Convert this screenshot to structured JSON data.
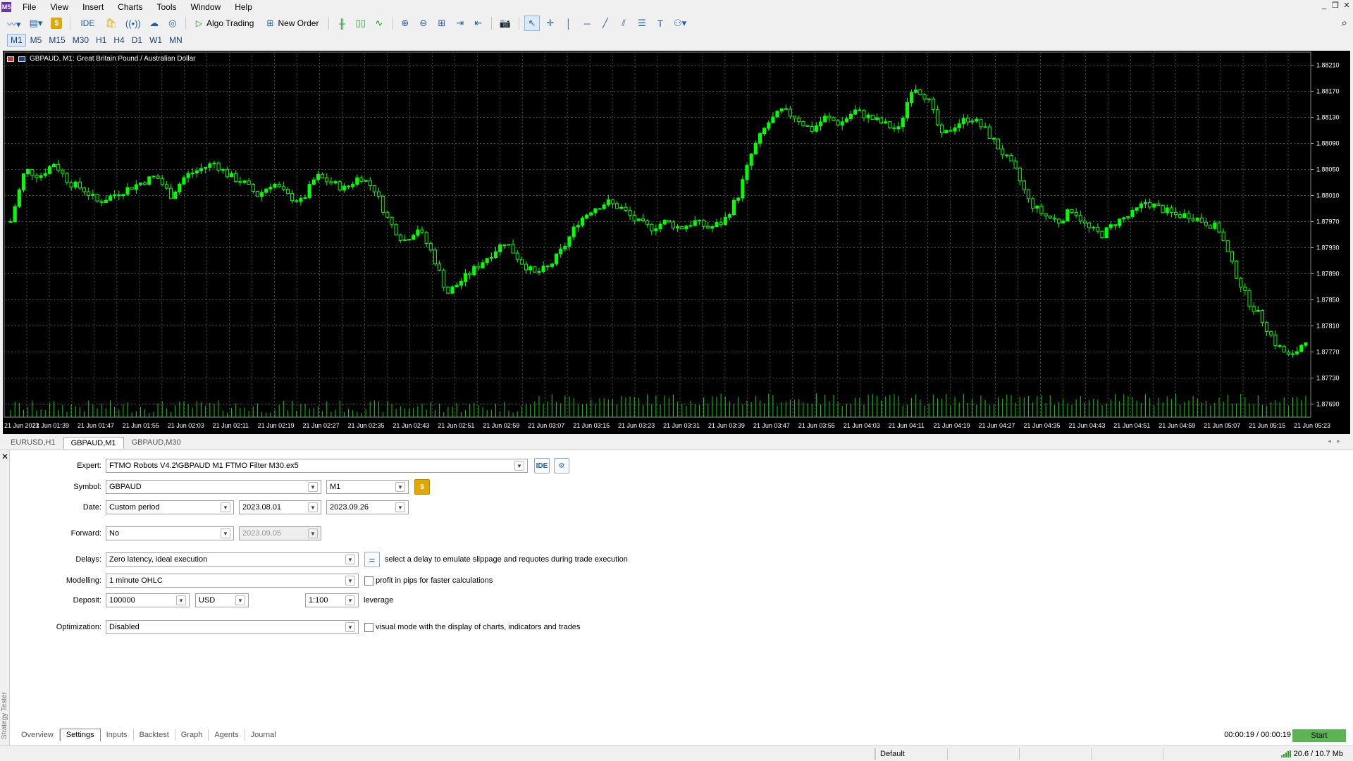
{
  "menu": [
    "File",
    "View",
    "Insert",
    "Charts",
    "Tools",
    "Window",
    "Help"
  ],
  "toolbar": {
    "ide_label": "IDE",
    "algo_trading_label": "Algo Trading",
    "new_order_label": "New Order"
  },
  "timeframes": [
    "M1",
    "M5",
    "M15",
    "M30",
    "H1",
    "H4",
    "D1",
    "W1",
    "MN"
  ],
  "active_timeframe": "M1",
  "chart": {
    "title": "GBPAUD, M1:  Great Britain Pound / Australian Dollar",
    "bull_color": "#00ff00",
    "bg_color": "#000000",
    "grid_color": "#4a4a4a"
  },
  "chart_data": {
    "type": "candlestick",
    "ylim": [
      1.8767,
      1.8823
    ],
    "y_ticks": [
      "1.88210",
      "1.88170",
      "1.88130",
      "1.88090",
      "1.88050",
      "1.88010",
      "1.87970",
      "1.87930",
      "1.87890",
      "1.87850",
      "1.87810",
      "1.87770",
      "1.87730",
      "1.87690"
    ],
    "x_ticks": [
      "21 Jun 2023",
      "21 Jun 01:39",
      "21 Jun 01:47",
      "21 Jun 01:55",
      "21 Jun 02:03",
      "21 Jun 02:11",
      "21 Jun 02:19",
      "21 Jun 02:27",
      "21 Jun 02:35",
      "21 Jun 02:43",
      "21 Jun 02:51",
      "21 Jun 02:59",
      "21 Jun 03:07",
      "21 Jun 03:15",
      "21 Jun 03:23",
      "21 Jun 03:31",
      "21 Jun 03:39",
      "21 Jun 03:47",
      "21 Jun 03:55",
      "21 Jun 04:03",
      "21 Jun 04:11",
      "21 Jun 04:19",
      "21 Jun 04:27",
      "21 Jun 04:35",
      "21 Jun 04:43",
      "21 Jun 04:51",
      "21 Jun 04:59",
      "21 Jun 05:07",
      "21 Jun 05:15",
      "21 Jun 05:23"
    ],
    "close_path": [
      1.8797,
      1.8805,
      1.8804,
      1.8806,
      1.8803,
      1.8802,
      1.88,
      1.8801,
      1.8802,
      1.8803,
      1.8804,
      1.8801,
      1.8804,
      1.8805,
      1.8806,
      1.8804,
      1.8803,
      1.8801,
      1.8803,
      1.8801,
      1.88,
      1.8804,
      1.8803,
      1.8802,
      1.8804,
      1.8802,
      1.8797,
      1.8794,
      1.8796,
      1.8792,
      1.8786,
      1.8788,
      1.879,
      1.8792,
      1.8794,
      1.8791,
      1.8789,
      1.879,
      1.8793,
      1.8797,
      1.8799,
      1.88,
      1.8799,
      1.8797,
      1.8796,
      1.8797,
      1.8796,
      1.8797,
      1.8796,
      1.8797,
      1.8801,
      1.8808,
      1.8812,
      1.8814,
      1.8813,
      1.8811,
      1.8813,
      1.8812,
      1.8814,
      1.8813,
      1.8812,
      1.8811,
      1.8818,
      1.8816,
      1.881,
      1.8812,
      1.8813,
      1.8811,
      1.8808,
      1.8805,
      1.88,
      1.8798,
      1.8797,
      1.8799,
      1.8796,
      1.8795,
      1.8797,
      1.8798,
      1.88,
      1.8799,
      1.8798,
      1.8798,
      1.8797,
      1.8796,
      1.879,
      1.8785,
      1.8782,
      1.8778,
      1.8776,
      1.8779
    ],
    "volume_note": "tick volume bars along bottom"
  },
  "chart_tabs": [
    "EURUSD,H1",
    "GBPAUD,M1",
    "GBPAUD,M30"
  ],
  "active_chart_tab": "GBPAUD,M1",
  "tester": {
    "side_label": "Strategy Tester",
    "expert_label": "Expert:",
    "expert_value": "FTMO Robots V4.2\\GBPAUD  M1 FTMO Filter M30.ex5",
    "expert_ide": "IDE",
    "symbol_label": "Symbol:",
    "symbol_value": "GBPAUD",
    "period_value": "M1",
    "date_label": "Date:",
    "date_mode": "Custom period",
    "date_from": "2023.08.01",
    "date_to": "2023.09.26",
    "forward_label": "Forward:",
    "forward_value": "No",
    "forward_date": "2023.09.05",
    "delays_label": "Delays:",
    "delays_value": "Zero latency, ideal execution",
    "delays_hint": "select a delay to emulate slippage and requotes during trade execution",
    "modelling_label": "Modelling:",
    "modelling_value": "1 minute OHLC",
    "pips_hint": "profit in pips for faster calculations",
    "deposit_label": "Deposit:",
    "deposit_value": "100000",
    "currency_value": "USD",
    "leverage_value": "1:100",
    "leverage_label": "leverage",
    "optimization_label": "Optimization:",
    "optimization_value": "Disabled",
    "visual_hint": "visual mode with the display of charts, indicators and trades",
    "tabs": [
      "Overview",
      "Settings",
      "Inputs",
      "Backtest",
      "Graph",
      "Agents",
      "Journal"
    ],
    "active_tab": "Settings",
    "timer": "00:00:19 / 00:00:19",
    "start_label": "Start"
  },
  "status": {
    "profile": "Default",
    "network": "20.6 / 10.7 Mb"
  }
}
